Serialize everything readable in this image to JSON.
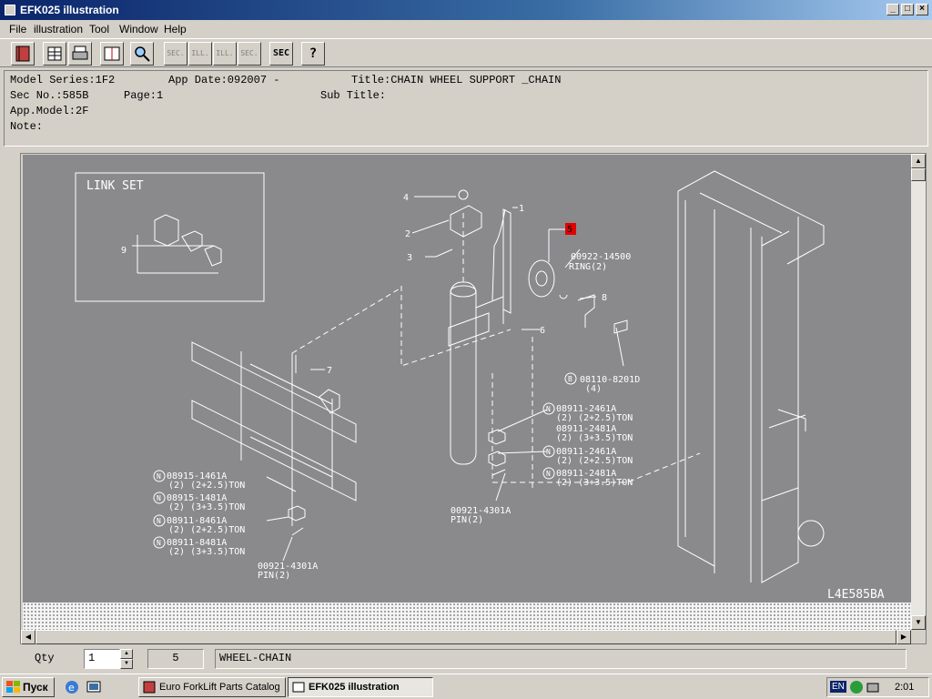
{
  "window": {
    "title": "EFK025 illustration",
    "controls": {
      "minimize": "_",
      "maximize": "□",
      "close": "×"
    }
  },
  "menu": {
    "items": [
      "File",
      "illustration",
      "Tool",
      "Window",
      "Help"
    ]
  },
  "toolbar": {
    "sec_back": "SEC.",
    "ill_back": "ILL.",
    "ill_forward": "ILL.",
    "sec_forward": "SEC.",
    "sec_search": "SEC",
    "help": "?"
  },
  "info": {
    "model_series": "Model Series:1F2",
    "app_date": "App Date:092007 -",
    "title": "Title:CHAIN WHEEL SUPPORT _CHAIN",
    "sec_no": "Sec No.:585B",
    "page": "Page:1",
    "sub_title": "Sub Title:",
    "app_model": "App.Model:2F",
    "note": "Note:"
  },
  "drawing": {
    "inset_title": "LINK SET",
    "inset_ref": "9",
    "refs": {
      "r1": "1",
      "r2": "2",
      "r3": "3",
      "r4": "4",
      "r5": "5",
      "r6": "6",
      "r7": "7",
      "r8": "8"
    },
    "ring_part": "00922-14500",
    "ring_label": "RING(2)",
    "bolt_part": "08110-8201D",
    "bolt_qty": "(4)",
    "nuts_right": [
      {
        "part": "08911-2461A",
        "desc": "(2)  (2+2.5)TON"
      },
      {
        "part": "08911-2481A",
        "desc": "(2)  (3+3.5)TON"
      },
      {
        "part": "08911-2461A",
        "desc": "(2)  (2+2.5)TON"
      },
      {
        "part": "08911-2481A",
        "desc": "(2)  (3+3.5)TON"
      }
    ],
    "pin_mid_part": "00921-4301A",
    "pin_mid_label": "PIN(2)",
    "nuts_left": [
      {
        "part": "08915-1461A",
        "desc": "(2)  (2+2.5)TON"
      },
      {
        "part": "08915-1481A",
        "desc": "(2)  (3+3.5)TON"
      },
      {
        "part": "08911-8461A",
        "desc": "(2)  (2+2.5)TON"
      },
      {
        "part": "08911-8481A",
        "desc": "(2)  (3+3.5)TON"
      }
    ],
    "pin_left_part": "00921-4301A",
    "pin_left_label": "PIN(2)",
    "drawing_code": "L4E585BA",
    "n_mark": "N",
    "b_mark": "B"
  },
  "footer": {
    "qty_label": "Qty",
    "qty_value": "1",
    "selected_ref": "5",
    "selected_name": "WHEEL-CHAIN"
  },
  "taskbar": {
    "start_label": "Пуск",
    "items": [
      "Euro ForkLift Parts Catalog",
      "EFK025 illustration"
    ],
    "lang": "EN",
    "clock": "2:01"
  },
  "colors": {
    "drawing_bg": "#8a8a8d",
    "line": "#ffffff",
    "highlight": "#e00000",
    "titlebar": "#0a246a"
  }
}
